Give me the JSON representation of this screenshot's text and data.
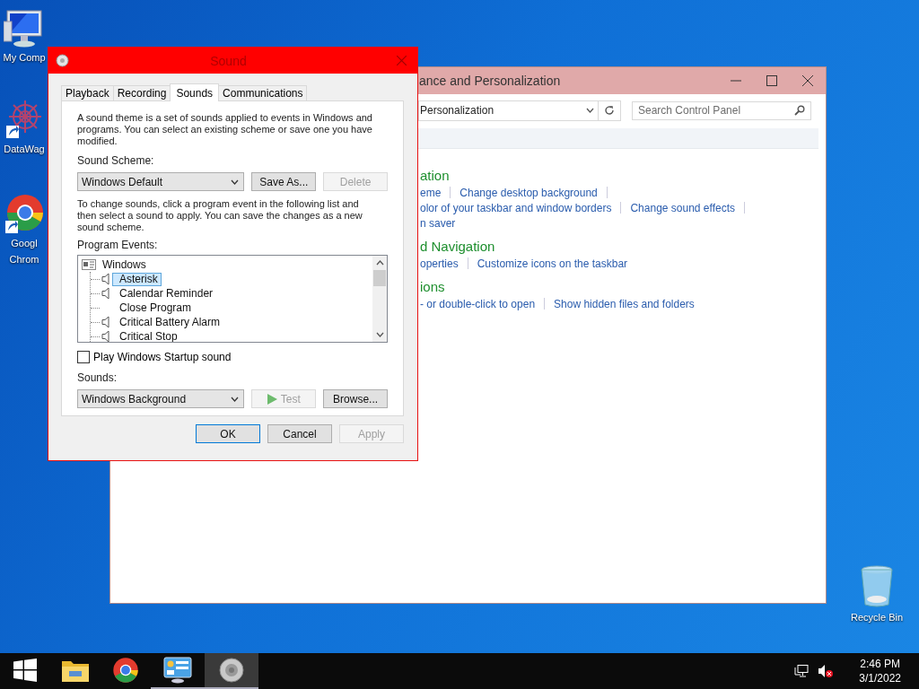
{
  "desktop_icons": [
    {
      "kind": "computer",
      "lines": [
        "My Comp"
      ]
    },
    {
      "kind": "starburst",
      "lines": [
        "DataWag"
      ]
    },
    {
      "kind": "browser",
      "lines": [
        "Googl",
        "Chrom"
      ]
    },
    {
      "kind": "recycle_bin",
      "lines": [
        "Recycle Bin"
      ]
    }
  ],
  "control_panel": {
    "title": "ance and Personalization",
    "address": "Personalization",
    "search_placeholder": "Search Control Panel",
    "sections": [
      {
        "heading": "ation",
        "rows": [
          {
            "links": [
              "eme",
              "Change desktop background"
            ],
            "trailing_separator": true
          },
          {
            "links": [
              "olor of your taskbar and window borders",
              "Change sound effects"
            ],
            "trailing_separator": true
          },
          {
            "links": [
              "n saver"
            ],
            "trailing_separator": false
          }
        ]
      },
      {
        "heading": "d Navigation",
        "rows": [
          {
            "links": [
              "operties",
              "Customize icons on the taskbar"
            ],
            "trailing_separator": false
          }
        ]
      },
      {
        "heading": "ions",
        "rows": [
          {
            "links": [
              "- or double-click to open",
              "Show hidden files and folders"
            ],
            "trailing_separator": false
          }
        ]
      }
    ]
  },
  "dialog": {
    "title": "Sound",
    "tabs": [
      {
        "label": "Playback",
        "selected": false
      },
      {
        "label": "Recording",
        "selected": false
      },
      {
        "label": "Sounds",
        "selected": true
      },
      {
        "label": "Communications",
        "selected": false
      }
    ],
    "description": "A sound theme is a set of sounds applied to events in Windows and programs.  You can select an existing scheme or save one you have modified.",
    "scheme_label": "Sound Scheme:",
    "scheme_value": "Windows Default",
    "scheme_buttons": [
      {
        "label": "Save As...",
        "disabled": false
      },
      {
        "label": "Delete",
        "disabled": true
      }
    ],
    "instructions": "To change sounds, click a program event in the following list and then select a sound to apply.  You can save the changes as a new sound scheme.",
    "events_label": "Program Events:",
    "program_events": [
      {
        "label": "Windows",
        "children": [
          {
            "label": "Asterisk",
            "has_sound": true,
            "selected": true
          },
          {
            "label": "Calendar Reminder",
            "has_sound": true,
            "selected": false
          },
          {
            "label": "Close Program",
            "has_sound": false,
            "selected": false
          },
          {
            "label": "Critical Battery Alarm",
            "has_sound": true,
            "selected": false
          },
          {
            "label": "Critical Stop",
            "has_sound": true,
            "selected": false
          }
        ]
      }
    ],
    "startup_sound": {
      "label": "Play Windows Startup sound",
      "checked": false
    },
    "sounds_label": "Sounds:",
    "sound_value": "Windows Background",
    "sound_buttons": [
      {
        "kind": "test",
        "label": "Test",
        "disabled": true
      },
      {
        "kind": "browse",
        "label": "Browse...",
        "disabled": false
      }
    ],
    "footer_buttons": [
      {
        "label": "OK",
        "default": true,
        "disabled": false
      },
      {
        "label": "Cancel",
        "default": false,
        "disabled": false
      },
      {
        "label": "Apply",
        "default": false,
        "disabled": true
      }
    ]
  },
  "taskbar": {
    "items": [
      {
        "kind": "start",
        "running": false,
        "selected": false
      },
      {
        "kind": "folder",
        "running": false,
        "selected": false
      },
      {
        "kind": "browser",
        "running": false,
        "selected": false
      },
      {
        "kind": "control_panel",
        "running": true,
        "selected": false
      },
      {
        "kind": "speaker",
        "running": true,
        "selected": true
      }
    ],
    "time": "2:46 PM",
    "date": "3/1/2022"
  }
}
